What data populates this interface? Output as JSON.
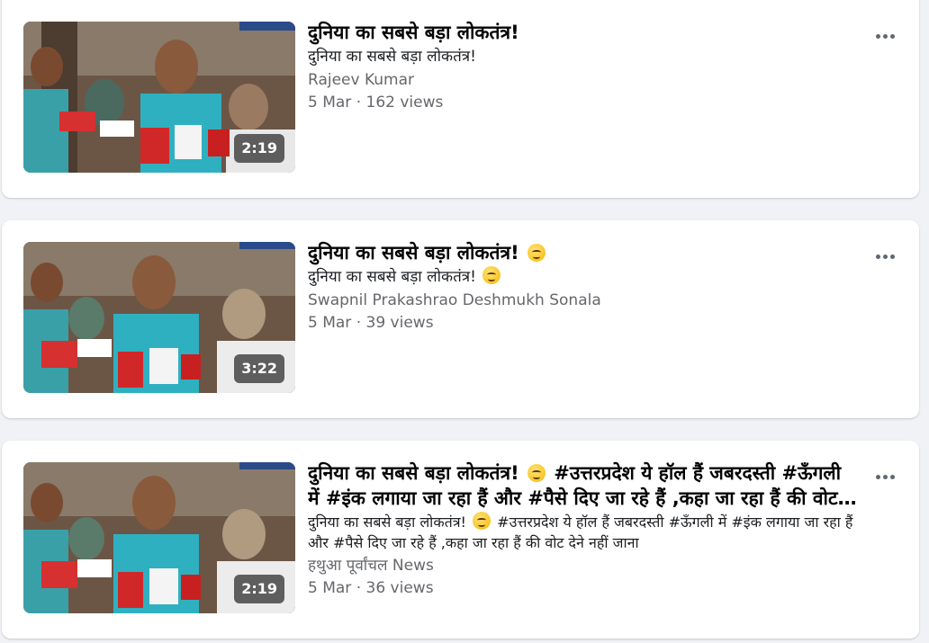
{
  "videos": [
    {
      "title": "दुनिया का सबसे बड़ा लोकतंत्र!",
      "description": "दुनिया का सबसे बड़ा लोकतंत्र!",
      "author": "Rajeev Kumar",
      "meta": "5 Mar · 162 views",
      "duration": "2:19"
    },
    {
      "title": "दुनिया का सबसे बड़ा लोकतंत्र!",
      "description": "दुनिया का सबसे बड़ा लोकतंत्र!",
      "author": "Swapnil Prakashrao Deshmukh Sonala",
      "meta": "5 Mar · 39 views",
      "duration": "3:22"
    },
    {
      "title_a": "दुनिया का सबसे बड़ा लोकतंत्र!",
      "title_b": "#उत्तरप्रदेश ये हॉल हैं जबरदस्ती #ऊँगली में #इंक लगाया जा रहा हैं और #पैसे दिए जा रहे हैं ,कहा जा रहा हैं की वोट देने नहीं जाना",
      "description_a": "दुनिया का सबसे बड़ा लोकतंत्र!",
      "description_b": "#उत्तरप्रदेश ये हॉल हैं जबरदस्ती #ऊँगली में #इंक लगाया जा रहा हैं और #पैसे दिए जा रहे हैं ,कहा जा रहा हैं की वोट देने नहीं जाना",
      "author": "हथुआ पूर्वांचल News",
      "meta": "5 Mar · 36 views",
      "duration": "2:19"
    }
  ],
  "icons": {
    "more": "more-horizontal-icon",
    "emoji": "smirk-emoji-icon"
  },
  "colors": {
    "background": "#f0f2f5",
    "card": "#ffffff",
    "title": "#050505",
    "secondary": "#65676b"
  }
}
